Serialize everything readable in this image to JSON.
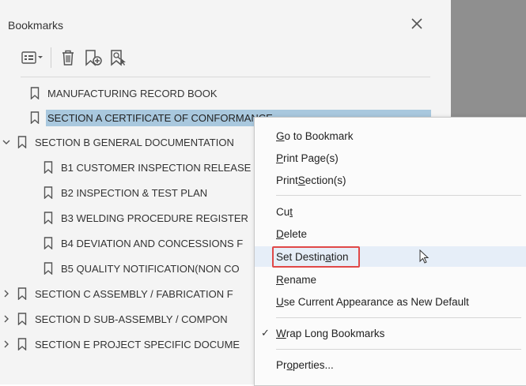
{
  "panel": {
    "title": "Bookmarks"
  },
  "toolbar": {
    "items": [
      {
        "name": "options-menu-icon"
      },
      {
        "name": "delete-bookmark-icon"
      },
      {
        "name": "new-bookmark-icon"
      },
      {
        "name": "find-bookmark-icon"
      }
    ]
  },
  "tree": [
    {
      "label": "MANUFACTURING RECORD BOOK",
      "indent": 0,
      "expander": "none",
      "selected": false
    },
    {
      "label": "SECTION A CERTIFICATE OF CONFORMANCE",
      "indent": 0,
      "expander": "none",
      "selected": true
    },
    {
      "label": "SECTION B GENERAL DOCUMENTATION",
      "indent": 0,
      "expander": "expanded",
      "selected": false
    },
    {
      "label": "B1 CUSTOMER INSPECTION RELEASE",
      "indent": 1,
      "expander": "none",
      "selected": false
    },
    {
      "label": "B2 INSPECTION & TEST PLAN",
      "indent": 1,
      "expander": "none",
      "selected": false
    },
    {
      "label": "B3 WELDING PROCEDURE REGISTER",
      "indent": 1,
      "expander": "none",
      "selected": false
    },
    {
      "label": "B4 DEVIATION AND CONCESSIONS F",
      "indent": 1,
      "expander": "none",
      "selected": false
    },
    {
      "label": "B5 QUALITY NOTIFICATION(NON CO",
      "indent": 1,
      "expander": "none",
      "selected": false
    },
    {
      "label": "SECTION C ASSEMBLY / FABRICATION F",
      "indent": 0,
      "expander": "collapsed",
      "selected": false
    },
    {
      "label": "SECTION D SUB-ASSEMBLY / COMPON",
      "indent": 0,
      "expander": "collapsed",
      "selected": false
    },
    {
      "label": "SECTION E PROJECT SPECIFIC DOCUME",
      "indent": 0,
      "expander": "collapsed",
      "selected": false
    }
  ],
  "context_menu": {
    "items": [
      {
        "pre": "",
        "key": "G",
        "post": "o to Bookmark",
        "label": "Go to Bookmark"
      },
      {
        "pre": "",
        "key": "P",
        "post": "rint Page(s)",
        "label": "Print Page(s)"
      },
      {
        "pre": "Print ",
        "key": "S",
        "post": "ection(s)",
        "label": "Print Section(s)"
      },
      {
        "pre": "Cu",
        "key": "t",
        "post": "",
        "label": "Cut"
      },
      {
        "pre": "",
        "key": "D",
        "post": "elete",
        "label": "Delete"
      },
      {
        "pre": "Set Destin",
        "key": "a",
        "post": "tion",
        "label": "Set Destination"
      },
      {
        "pre": "",
        "key": "R",
        "post": "ename",
        "label": "Rename"
      },
      {
        "pre": "",
        "key": "U",
        "post": "se Current Appearance as New Default",
        "label": "Use Current Appearance as New Default"
      },
      {
        "pre": "",
        "key": "W",
        "post": "rap Long Bookmarks",
        "label": "Wrap Long Bookmarks",
        "checked": true
      },
      {
        "pre": "Pr",
        "key": "o",
        "post": "perties...",
        "label": "Properties..."
      }
    ],
    "highlighted": "Set Destination",
    "check_glyph": "✓"
  },
  "colors": {
    "panel_bg": "#f4f4f4",
    "selection": "#a9c8de",
    "menu_hover": "#e6eef8",
    "highlight_border": "#e04848",
    "document_bg": "#8f8f8f"
  }
}
